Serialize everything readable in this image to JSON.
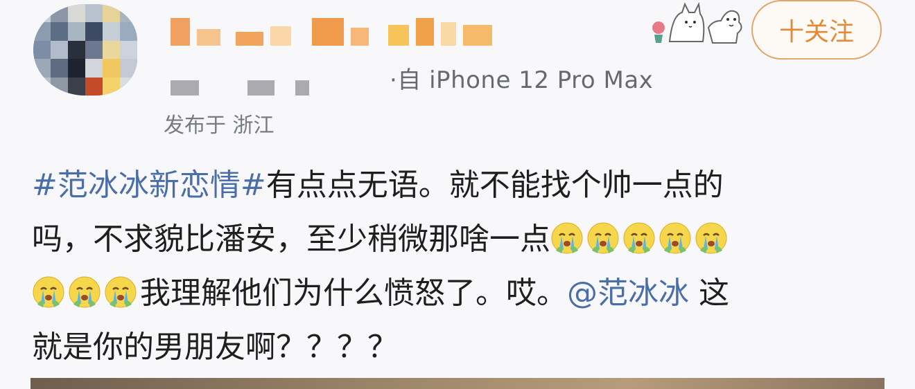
{
  "header": {
    "source_text": "·自 iPhone 12 Pro Max",
    "location_text": "发布于 浙江",
    "follow_label": "十关注"
  },
  "post": {
    "hashtag": "#范冰冰新恋情#",
    "line1_rest": "有点点无语。就不能找个帅一点的",
    "line2": "吗，不求貌比潘安，至少稍微那啥一点",
    "line3_text": "我理解他们为什么愤怒了。哎。",
    "mention": "@范冰冰",
    "line3_tail": " 这",
    "line4": "就是你的男朋友啊？？？？",
    "emoji_name": "crying-face-emoji",
    "emoji_count_line2": 5,
    "emoji_count_line3": 3
  },
  "colors": {
    "link": "#4a6fa8",
    "follow_accent": "#e08a3a",
    "follow_border": "#e0a56a",
    "background": "#f8f8fa"
  },
  "icons": {
    "sticker": "cat-sticker-icon",
    "avatar": "blurred-avatar"
  }
}
